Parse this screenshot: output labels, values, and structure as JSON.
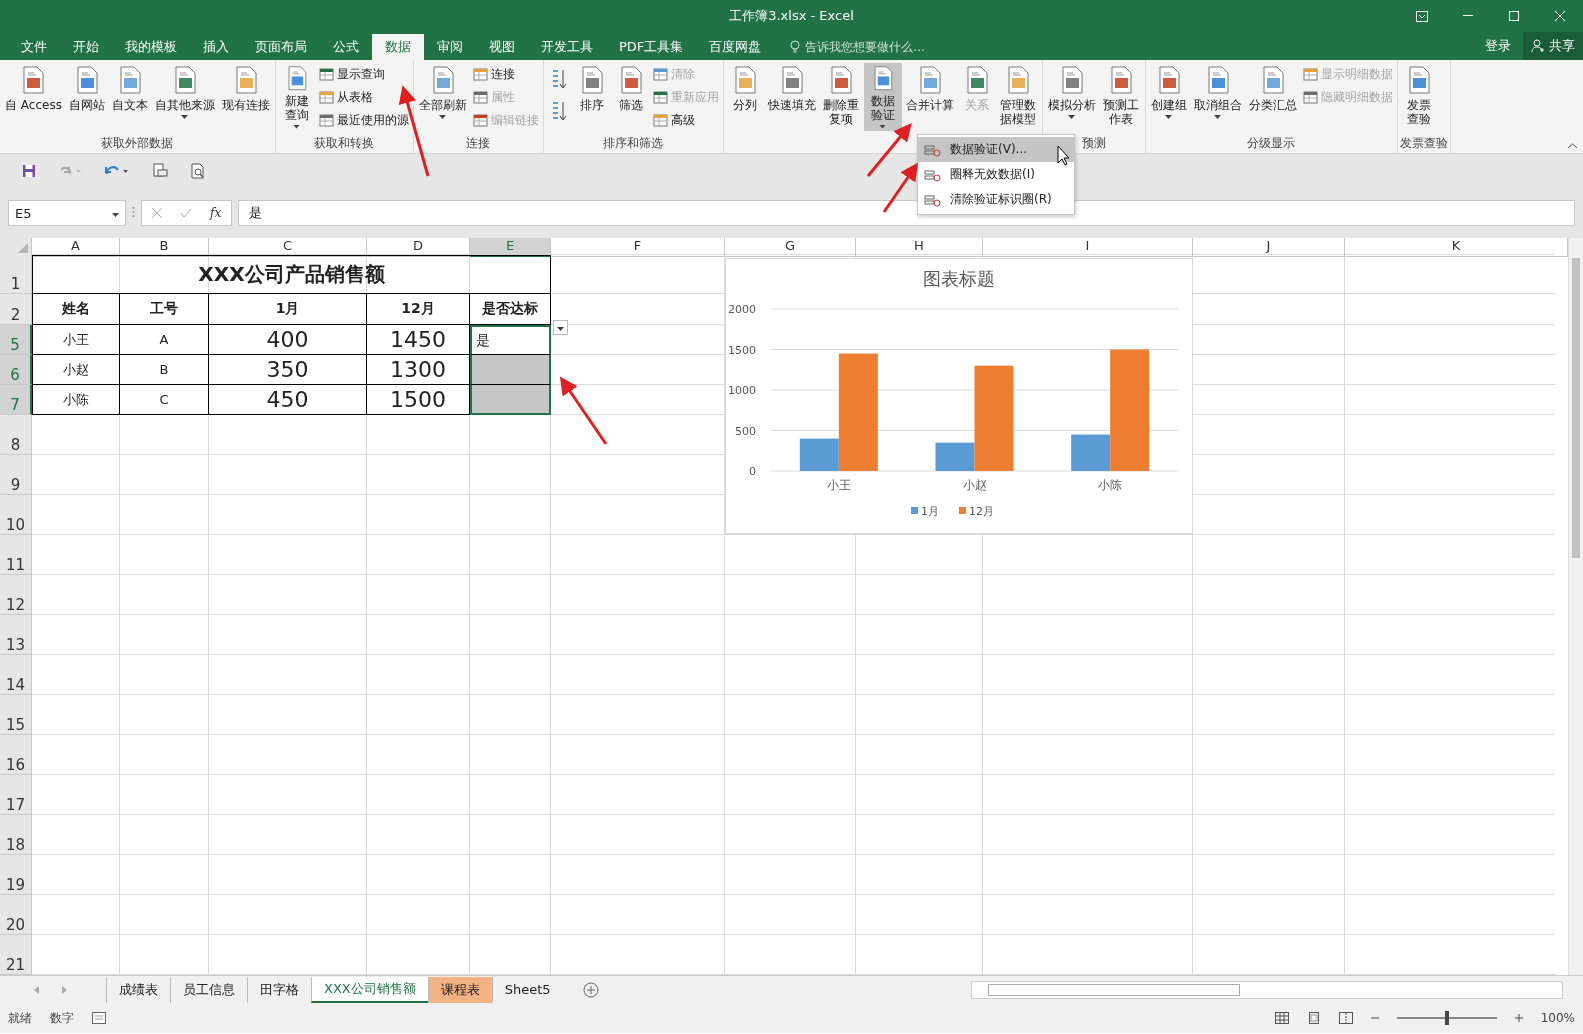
{
  "window": {
    "title": "工作簿3.xlsx - Excel"
  },
  "tabs": [
    {
      "label": "文件",
      "selected": false
    },
    {
      "label": "开始",
      "selected": false
    },
    {
      "label": "我的模板",
      "selected": false
    },
    {
      "label": "插入",
      "selected": false
    },
    {
      "label": "页面布局",
      "selected": false
    },
    {
      "label": "公式",
      "selected": false
    },
    {
      "label": "数据",
      "selected": true
    },
    {
      "label": "审阅",
      "selected": false
    },
    {
      "label": "视图",
      "selected": false
    },
    {
      "label": "开发工具",
      "selected": false
    },
    {
      "label": "PDF工具集",
      "selected": false
    },
    {
      "label": "百度网盘",
      "selected": false
    }
  ],
  "tell_me": {
    "placeholder": "告诉我您想要做什么..."
  },
  "account": {
    "sign_in": "登录",
    "share": "共享"
  },
  "ribbon": {
    "groups": [
      {
        "label": "获取外部数据",
        "items": [
          {
            "kind": "large",
            "label": "自 Access",
            "menu": false,
            "pressed": false,
            "disabled": false
          },
          {
            "kind": "large",
            "label": "自网站",
            "menu": false,
            "pressed": false,
            "disabled": false
          },
          {
            "kind": "large",
            "label": "自文本",
            "menu": false,
            "pressed": false,
            "disabled": false
          },
          {
            "kind": "large",
            "label": "自其他来源",
            "menu": true,
            "pressed": false,
            "disabled": false
          },
          {
            "kind": "large",
            "label": "现有连接",
            "menu": false,
            "pressed": false,
            "disabled": false
          }
        ]
      },
      {
        "label": "获取和转换",
        "items": [
          {
            "kind": "large-two-line",
            "label": "新建查询",
            "menu": true,
            "pressed": false,
            "disabled": false
          },
          {
            "kind": "small",
            "label": "显示查询",
            "disabled": false
          },
          {
            "kind": "small",
            "label": "从表格",
            "disabled": false
          },
          {
            "kind": "small",
            "label": "最近使用的源",
            "disabled": false
          }
        ]
      },
      {
        "label": "连接",
        "items": [
          {
            "kind": "large",
            "label": "全部刷新",
            "menu": true,
            "pressed": false,
            "disabled": false
          },
          {
            "kind": "small",
            "label": "连接",
            "disabled": false
          },
          {
            "kind": "small",
            "label": "属性",
            "disabled": true
          },
          {
            "kind": "small",
            "label": "编辑链接",
            "disabled": true
          }
        ]
      },
      {
        "label": "排序和筛选",
        "items": [
          {
            "kind": "sort"
          },
          {
            "kind": "sort"
          },
          {
            "kind": "large",
            "label": "排序",
            "menu": false,
            "pressed": false,
            "disabled": false
          },
          {
            "kind": "large",
            "label": "筛选",
            "menu": false,
            "pressed": false,
            "disabled": false
          },
          {
            "kind": "small",
            "label": "清除",
            "disabled": true
          },
          {
            "kind": "small",
            "label": "重新应用",
            "disabled": true
          },
          {
            "kind": "small",
            "label": "高级",
            "disabled": false
          }
        ]
      },
      {
        "items": [
          {
            "kind": "large",
            "label": "分列",
            "menu": false,
            "pressed": false,
            "disabled": false
          },
          {
            "kind": "large",
            "label": "快速填充",
            "menu": false,
            "pressed": false,
            "disabled": false
          },
          {
            "kind": "large-two-line",
            "label": "删除重复项",
            "menu": false,
            "pressed": false,
            "disabled": false
          },
          {
            "kind": "large-two-line",
            "label": "数据验证",
            "menu": true,
            "pressed": true,
            "disabled": false
          },
          {
            "kind": "large",
            "label": "合并计算",
            "menu": false,
            "pressed": false,
            "disabled": false
          },
          {
            "kind": "large",
            "label": "关系",
            "menu": false,
            "pressed": false,
            "disabled": true
          },
          {
            "kind": "large-two-line",
            "label": "管理数据模型",
            "menu": false,
            "pressed": false,
            "disabled": false
          }
        ]
      },
      {
        "label": "预测",
        "items": [
          {
            "kind": "large",
            "label": "模拟分析",
            "menu": true,
            "pressed": false,
            "disabled": false
          },
          {
            "kind": "large-two-line",
            "label": "预测工作表",
            "menu": false,
            "pressed": false,
            "disabled": false
          }
        ]
      },
      {
        "label": "分级显示",
        "items": [
          {
            "kind": "large",
            "label": "创建组",
            "menu": true,
            "pressed": false,
            "disabled": false
          },
          {
            "kind": "large",
            "label": "取消组合",
            "menu": true,
            "pressed": false,
            "disabled": false
          },
          {
            "kind": "large",
            "label": "分类汇总",
            "menu": false,
            "pressed": false,
            "disabled": false
          },
          {
            "kind": "small",
            "label": "显示明细数据",
            "disabled": true
          },
          {
            "kind": "small",
            "label": "隐藏明细数据",
            "disabled": true
          }
        ]
      },
      {
        "label": "发票查验",
        "items": [
          {
            "kind": "large-two-line",
            "label": "发票查验",
            "menu": false,
            "pressed": false,
            "disabled": false
          }
        ]
      }
    ]
  },
  "menu": {
    "items": [
      {
        "label": "数据验证(V)...",
        "selected": true
      },
      {
        "label": "圈释无效数据(I)",
        "selected": false
      },
      {
        "label": "清除验证标识圈(R)",
        "selected": false
      }
    ]
  },
  "formula_bar": {
    "name_box": "E5",
    "fx_label": "fx",
    "value": "是"
  },
  "sheet": {
    "columns": [
      {
        "label": "A",
        "selected": false
      },
      {
        "label": "B",
        "selected": false
      },
      {
        "label": "C",
        "selected": false
      },
      {
        "label": "D",
        "selected": false
      },
      {
        "label": "E",
        "selected": true
      },
      {
        "label": "F",
        "selected": false
      },
      {
        "label": "G",
        "selected": false
      },
      {
        "label": "H",
        "selected": false
      },
      {
        "label": "I",
        "selected": false
      },
      {
        "label": "J",
        "selected": false
      },
      {
        "label": "K",
        "selected": false
      }
    ],
    "rows": [
      {
        "number": "1",
        "selected": false,
        "kind": "title",
        "cells": [
          "XXX公司产品销售额"
        ]
      },
      {
        "number": "2",
        "selected": false,
        "kind": "header",
        "cells": [
          "姓名",
          "工号",
          "1月",
          "12月",
          "是否达标"
        ]
      },
      {
        "number": "5",
        "selected": true,
        "kind": "data",
        "cells": [
          "小王",
          "A",
          "400",
          "1450",
          "是"
        ]
      },
      {
        "number": "6",
        "selected": true,
        "kind": "data",
        "cells": [
          "小赵",
          "B",
          "350",
          "1300"
        ]
      },
      {
        "number": "7",
        "selected": true,
        "kind": "data",
        "cells": [
          "小陈",
          "C",
          "450",
          "1500"
        ]
      },
      {
        "number": "8",
        "selected": false,
        "kind": "empty"
      },
      {
        "number": "9",
        "selected": false,
        "kind": "empty"
      },
      {
        "number": "10",
        "selected": false,
        "kind": "empty"
      },
      {
        "number": "11",
        "selected": false,
        "kind": "empty"
      },
      {
        "number": "12",
        "selected": false,
        "kind": "empty"
      },
      {
        "number": "13",
        "selected": false,
        "kind": "empty"
      },
      {
        "number": "14",
        "selected": false,
        "kind": "empty"
      },
      {
        "number": "15",
        "selected": false,
        "kind": "empty"
      },
      {
        "number": "16",
        "selected": false,
        "kind": "empty"
      },
      {
        "number": "17",
        "selected": false,
        "kind": "empty"
      },
      {
        "number": "18",
        "selected": false,
        "kind": "empty"
      },
      {
        "number": "19",
        "selected": false,
        "kind": "empty"
      },
      {
        "number": "20",
        "selected": false,
        "kind": "empty"
      },
      {
        "number": "21",
        "selected": false,
        "kind": "empty"
      }
    ],
    "chart": {
      "chart_data": {
        "type": "bar",
        "title": "图表标题",
        "categories": [
          "小王",
          "小赵",
          "小陈"
        ],
        "series": [
          {
            "name": "1月",
            "color": "#5b9bd5",
            "values": [
              400,
              350,
              450
            ]
          },
          {
            "name": "12月",
            "color": "#ed7d31",
            "values": [
              1450,
              1300,
              1500
            ]
          }
        ],
        "ylim": [
          0,
          2000
        ],
        "yticks": [
          0,
          500,
          1000,
          1500,
          2000
        ],
        "grid": true,
        "legend": "bottom"
      }
    }
  },
  "sheet_tabs": [
    {
      "label": "成绩表",
      "selected": false
    },
    {
      "label": "员工信息",
      "selected": false
    },
    {
      "label": "田字格",
      "selected": false
    },
    {
      "label": "XXX公司销售额",
      "selected": true
    },
    {
      "label": "课程表",
      "selected": false,
      "color": "#f4b183"
    },
    {
      "label": "Sheet5",
      "selected": false
    }
  ],
  "status_bar": {
    "items": [
      "就绪",
      "数字"
    ],
    "zoom": {
      "level": 0.5,
      "reading": "100%"
    }
  }
}
